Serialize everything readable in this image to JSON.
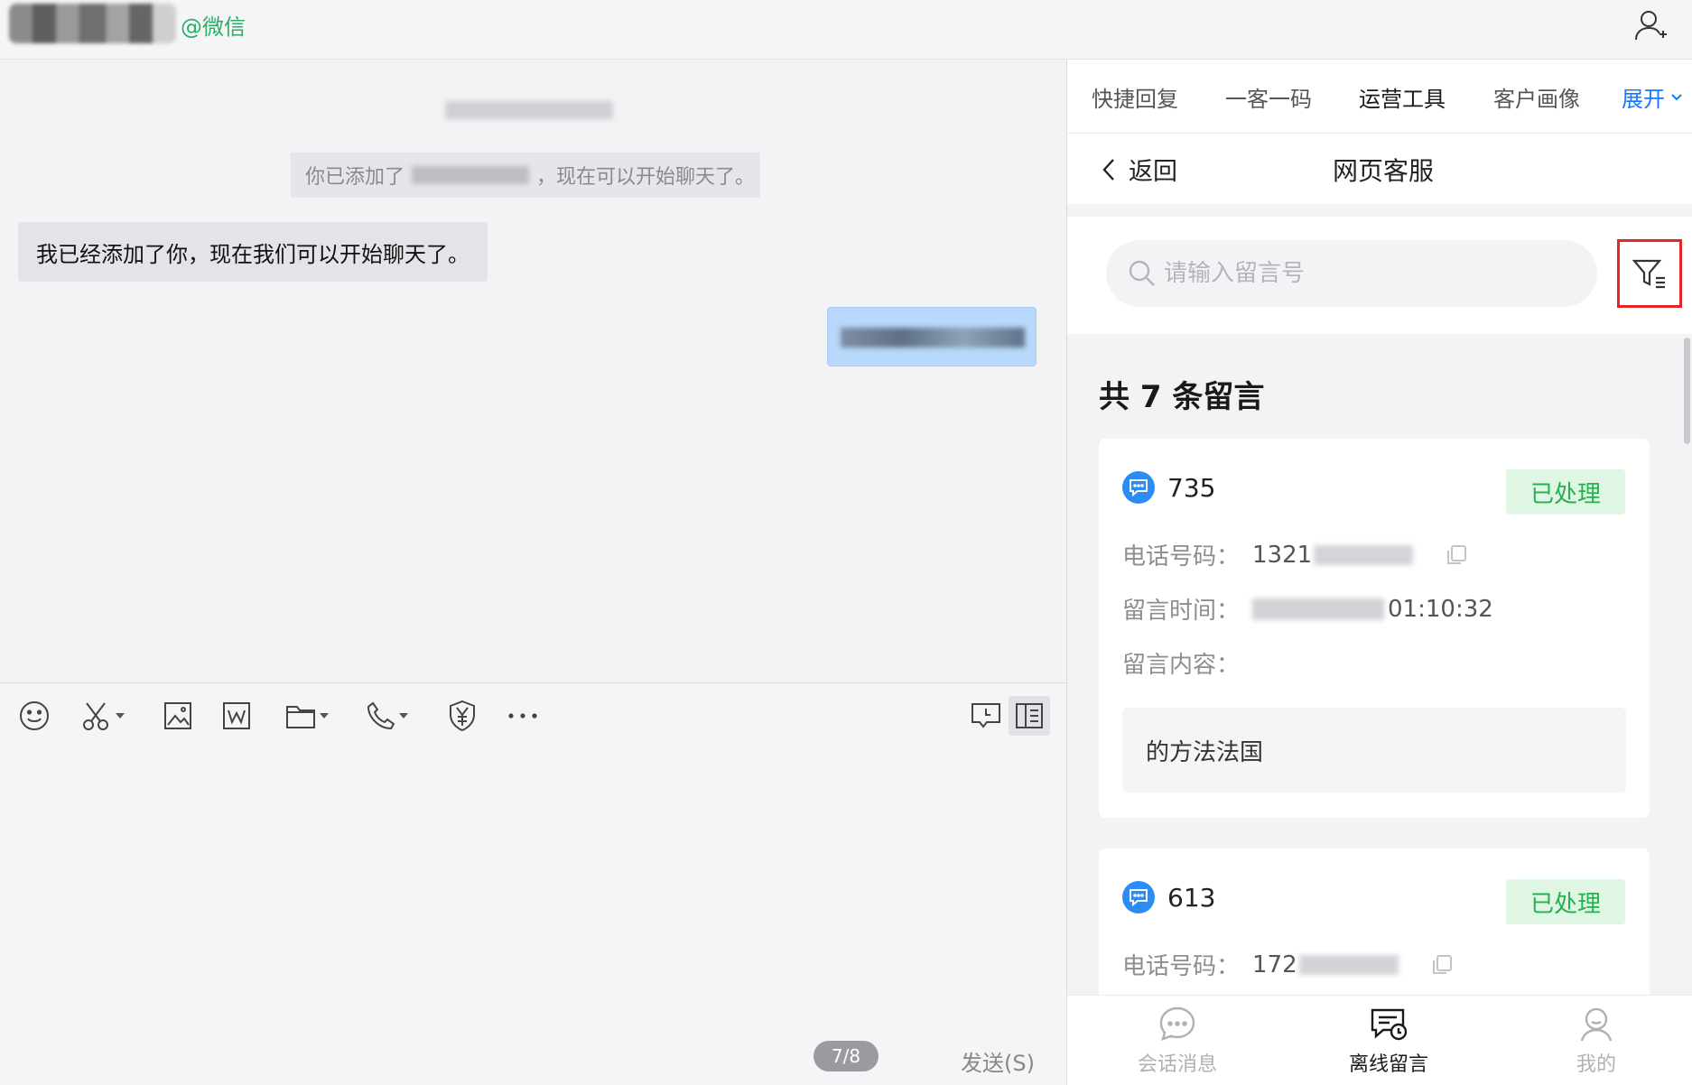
{
  "header": {
    "contact_source": "@微信"
  },
  "chat": {
    "system_message_prefix": "你已添加了",
    "system_message_suffix": "，现在可以开始聊天了。",
    "received_message": "我已经添加了你，现在我们可以开始聊天了。"
  },
  "toolbar": {
    "icons": [
      "emoji-icon",
      "screenshot-icon",
      "image-icon",
      "word-file-icon",
      "folder-icon",
      "phone-icon",
      "payment-icon",
      "more-icon"
    ]
  },
  "input": {
    "page_indicator": "7/8",
    "send_label": "发送(S)"
  },
  "panel": {
    "tabs": [
      {
        "label": "快捷回复"
      },
      {
        "label": "一客一码"
      },
      {
        "label": "运营工具"
      },
      {
        "label": "客户画像"
      }
    ],
    "expand_label": "展开",
    "back_label": "返回",
    "title": "网页客服",
    "search_placeholder": "请输入留言号",
    "total_text": "共 7 条留言",
    "cards": [
      {
        "id": "735",
        "status": "已处理",
        "phone_label": "电话号码：",
        "phone_prefix": "1321",
        "time_label": "留言时间：",
        "time_suffix": "01:10:32",
        "content_label": "留言内容：",
        "content": "的方法法国"
      },
      {
        "id": "613",
        "status": "已处理",
        "phone_label": "电话号码：",
        "phone_prefix": "172"
      }
    ],
    "nav": [
      {
        "label": "会话消息"
      },
      {
        "label": "离线留言"
      },
      {
        "label": "我的"
      }
    ]
  },
  "colors": {
    "accent": "#1677ff",
    "wechat_green": "#2aae67",
    "status_green": "#27b04d",
    "highlight_red": "#e32626"
  }
}
